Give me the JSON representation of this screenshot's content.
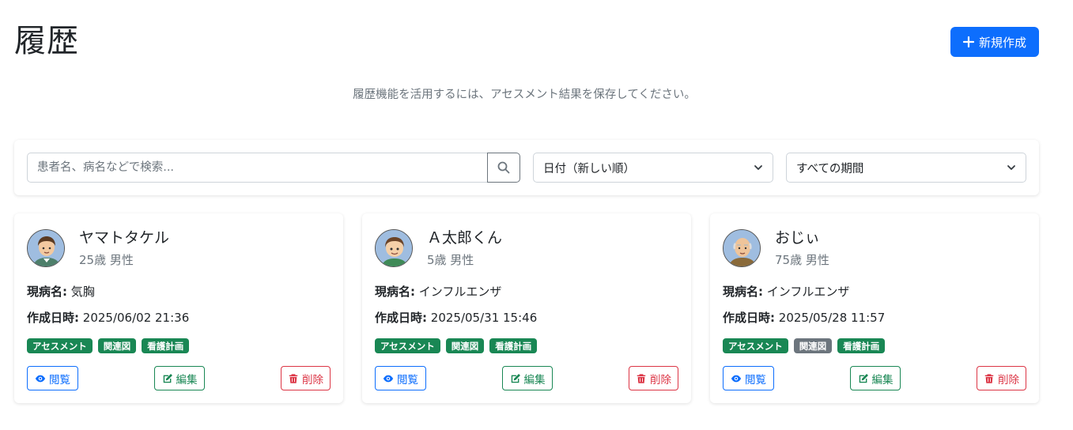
{
  "header": {
    "title": "履歴",
    "new_button_label": "新規作成",
    "info": "履歴機能を活用するには、アセスメント結果を保存してください。"
  },
  "search": {
    "placeholder": "患者名、病名などで検索...",
    "sort_value": "日付（新しい順）",
    "period_value": "すべての期間"
  },
  "labels": {
    "diagnosis": "現病名:",
    "created": "作成日時:",
    "view": "閲覧",
    "edit": "編集",
    "delete": "削除"
  },
  "records": [
    {
      "name": "ヤマトタケル",
      "info": "25歳 男性",
      "diagnosis": "気胸",
      "created": "2025/06/02 21:36",
      "tags": [
        {
          "label": "アセスメント",
          "active": true
        },
        {
          "label": "関連図",
          "active": true
        },
        {
          "label": "看護計画",
          "active": true
        }
      ]
    },
    {
      "name": "Ａ太郎くん",
      "info": "5歳 男性",
      "diagnosis": "インフルエンザ",
      "created": "2025/05/31 15:46",
      "tags": [
        {
          "label": "アセスメント",
          "active": true
        },
        {
          "label": "関連図",
          "active": true
        },
        {
          "label": "看護計画",
          "active": true
        }
      ]
    },
    {
      "name": "おじぃ",
      "info": "75歳 男性",
      "diagnosis": "インフルエンザ",
      "created": "2025/05/28 11:57",
      "tags": [
        {
          "label": "アセスメント",
          "active": true
        },
        {
          "label": "関連図",
          "active": false
        },
        {
          "label": "看護計画",
          "active": true
        }
      ]
    }
  ],
  "colors": {
    "primary": "#0d6efd",
    "success": "#198754",
    "danger": "#dc3545",
    "secondary": "#6c757d"
  }
}
